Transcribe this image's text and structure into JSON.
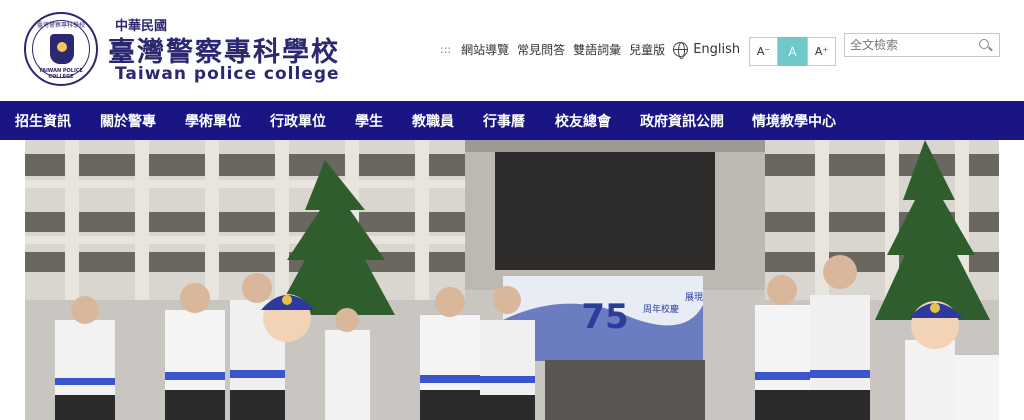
{
  "header": {
    "logo": {
      "subtitle": "中華民國",
      "title": "臺灣警察專科學校",
      "english": "Taiwan police college",
      "seal_text_top": "臺灣警察專科學校",
      "seal_text_bottom": "TAIWAN POLICE COLLEGE"
    },
    "toplinks": {
      "dots": ":::",
      "items": [
        "網站導覽",
        "常見問答",
        "雙語詞彙",
        "兒童版"
      ],
      "english_label": "English"
    },
    "font_size": {
      "small": "A⁻",
      "medium": "A",
      "large": "A⁺"
    },
    "search": {
      "placeholder": "全文檢索"
    }
  },
  "nav": {
    "items": [
      "招生資訊",
      "關於警專",
      "學術單位",
      "行政單位",
      "學生",
      "教職員",
      "行事曆",
      "校友總會",
      "政府資訊公開",
      "情境教學中心"
    ]
  },
  "hero": {
    "banner_text": "75",
    "banner_sub": "周年校慶",
    "banner_side": "展現"
  },
  "colors": {
    "brand": "#2b2770",
    "nav_bg": "#1a1585",
    "accent": "#6fc9c9"
  }
}
